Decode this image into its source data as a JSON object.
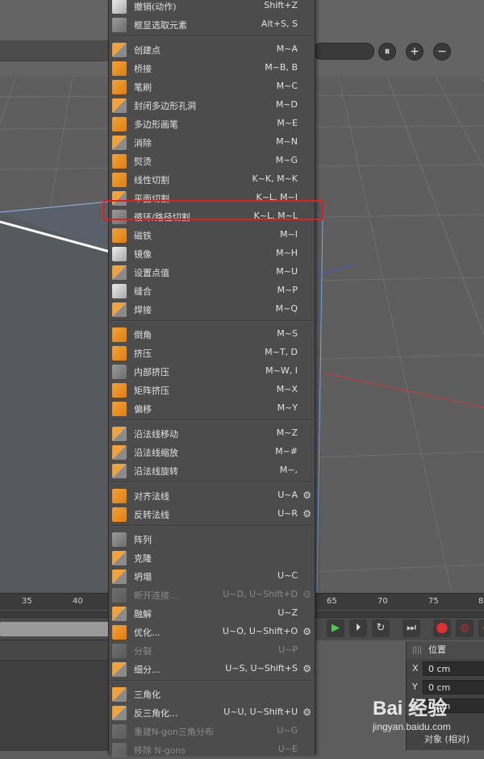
{
  "viewport": {
    "buttons": [
      {
        "icon": "pause-icon",
        "glyph": "⏸"
      },
      {
        "icon": "plus-icon",
        "glyph": "+"
      },
      {
        "icon": "minus-icon",
        "glyph": "−"
      }
    ]
  },
  "timeline": {
    "ticks": [
      "35",
      "40",
      "65",
      "70",
      "75",
      "8"
    ]
  },
  "transport": {
    "buttons": [
      {
        "icon": "play-icon",
        "glyph": "▶"
      },
      {
        "icon": "step-forward-icon",
        "glyph": "⏵"
      },
      {
        "icon": "loop-icon",
        "glyph": "↻"
      },
      {
        "icon": "go-to-end-icon",
        "glyph": "⏭"
      },
      {
        "icon": "record-key-icon",
        "glyph": "⬤"
      },
      {
        "icon": "auto-key-icon",
        "glyph": "◎"
      },
      {
        "icon": "keyframe-icon",
        "glyph": "◉"
      }
    ]
  },
  "coordinates": {
    "title": "位置",
    "rows": [
      {
        "axis": "X",
        "value": "0 cm"
      },
      {
        "axis": "Y",
        "value": "0 cm"
      },
      {
        "axis": "Z",
        "value": "0 cm"
      }
    ],
    "mode": "对象 (相对)"
  },
  "watermark": {
    "brand": "Bai 经验",
    "url": "jingyan.baidu.com"
  },
  "menu": {
    "groups": [
      [
        {
          "label": "撤销(动作)",
          "shortcut": "Shift+Z",
          "icon": "undo-icon",
          "style": "w"
        },
        {
          "label": "框显选取元素",
          "shortcut": "Alt+S, S",
          "icon": "frame-selected-icon",
          "style": "g"
        }
      ],
      [
        {
          "label": "创建点",
          "shortcut": "M~A",
          "icon": "create-point-icon",
          "style": "og"
        },
        {
          "label": "桥接",
          "shortcut": "M~B, B",
          "icon": "bridge-icon",
          "style": "o"
        },
        {
          "label": "笔刷",
          "shortcut": "M~C",
          "icon": "brush-icon",
          "style": "o"
        },
        {
          "label": "封闭多边形孔洞",
          "shortcut": "M~D",
          "icon": "close-hole-icon",
          "style": "og"
        },
        {
          "label": "多边形画笔",
          "shortcut": "M~E",
          "icon": "polygon-pen-icon",
          "style": "o"
        },
        {
          "label": "消除",
          "shortcut": "M~N",
          "icon": "dissolve-icon",
          "style": "og"
        },
        {
          "label": "熨烫",
          "shortcut": "M~G",
          "icon": "iron-icon",
          "style": "o"
        },
        {
          "label": "线性切割",
          "shortcut": "K~K, M~K",
          "icon": "knife-icon",
          "style": "o"
        },
        {
          "label": "平面切割",
          "shortcut": "K~L, M~J",
          "icon": "plane-cut-icon",
          "style": "og"
        },
        {
          "label": "循环/路径切割",
          "shortcut": "K~L, M~L",
          "icon": "loop-path-cut-icon",
          "style": "g"
        },
        {
          "label": "磁铁",
          "shortcut": "M~I",
          "icon": "magnet-icon",
          "style": "o"
        },
        {
          "label": "镜像",
          "shortcut": "M~H",
          "icon": "mirror-icon",
          "style": "w"
        },
        {
          "label": "设置点值",
          "shortcut": "M~U",
          "icon": "set-point-value-icon",
          "style": "og"
        },
        {
          "label": "缝合",
          "shortcut": "M~P",
          "icon": "stitch-icon",
          "style": "w"
        },
        {
          "label": "焊接",
          "shortcut": "M~Q",
          "icon": "weld-icon",
          "style": "og"
        }
      ],
      [
        {
          "label": "倒角",
          "shortcut": "M~S",
          "icon": "bevel-icon",
          "style": "o"
        },
        {
          "label": "挤压",
          "shortcut": "M~T, D",
          "icon": "extrude-icon",
          "style": "o"
        },
        {
          "label": "内部挤压",
          "shortcut": "M~W, I",
          "icon": "extrude-inner-icon",
          "style": "g"
        },
        {
          "label": "矩阵挤压",
          "shortcut": "M~X",
          "icon": "matrix-extrude-icon",
          "style": "o"
        },
        {
          "label": "偏移",
          "shortcut": "M~Y",
          "icon": "offset-icon",
          "style": "o"
        }
      ],
      [
        {
          "label": "沿法线移动",
          "shortcut": "M~Z",
          "icon": "normal-move-icon",
          "style": "og"
        },
        {
          "label": "沿法线缩放",
          "shortcut": "M~#",
          "icon": "normal-scale-icon",
          "style": "og"
        },
        {
          "label": "沿法线旋转",
          "shortcut": "M~,",
          "icon": "normal-rotate-icon",
          "style": "og"
        }
      ],
      [
        {
          "label": "对齐法线",
          "shortcut": "U~A",
          "icon": "align-normals-icon",
          "style": "o",
          "gear": true
        },
        {
          "label": "反转法线",
          "shortcut": "U~R",
          "icon": "reverse-normals-icon",
          "style": "o",
          "gear": true
        }
      ],
      [
        {
          "label": "阵列",
          "shortcut": "",
          "icon": "array-icon",
          "style": "g"
        },
        {
          "label": "克隆",
          "shortcut": "",
          "icon": "clone-icon",
          "style": "og"
        },
        {
          "label": "坍塌",
          "shortcut": "U~C",
          "icon": "collapse-icon",
          "style": "og"
        },
        {
          "label": "断开连接...",
          "shortcut": "U~D, U~Shift+D",
          "icon": "disconnect-icon",
          "style": "g",
          "disabled": true,
          "gear": true
        },
        {
          "label": "融解",
          "shortcut": "U~Z",
          "icon": "melt-icon",
          "style": "og"
        },
        {
          "label": "优化...",
          "shortcut": "U~O, U~Shift+O",
          "icon": "optimize-icon",
          "style": "o",
          "gear": true
        },
        {
          "label": "分裂",
          "shortcut": "U~P",
          "icon": "split-icon",
          "style": "g",
          "disabled": true
        },
        {
          "label": "细分...",
          "shortcut": "U~S, U~Shift+S",
          "icon": "subdivide-icon",
          "style": "og",
          "gear": true
        }
      ],
      [
        {
          "label": "三角化",
          "shortcut": "",
          "icon": "triangulate-icon",
          "style": "og"
        },
        {
          "label": "反三角化...",
          "shortcut": "U~U, U~Shift+U",
          "icon": "untriangulate-icon",
          "style": "og",
          "gear": true
        },
        {
          "label": "重建N-gon三角分布",
          "shortcut": "U~G",
          "icon": "retriangulate-ngons-icon",
          "style": "g",
          "disabled": true
        },
        {
          "label": "移除 N-gons",
          "shortcut": "U~E",
          "icon": "remove-ngons-icon",
          "style": "g",
          "disabled": true
        }
      ]
    ]
  }
}
